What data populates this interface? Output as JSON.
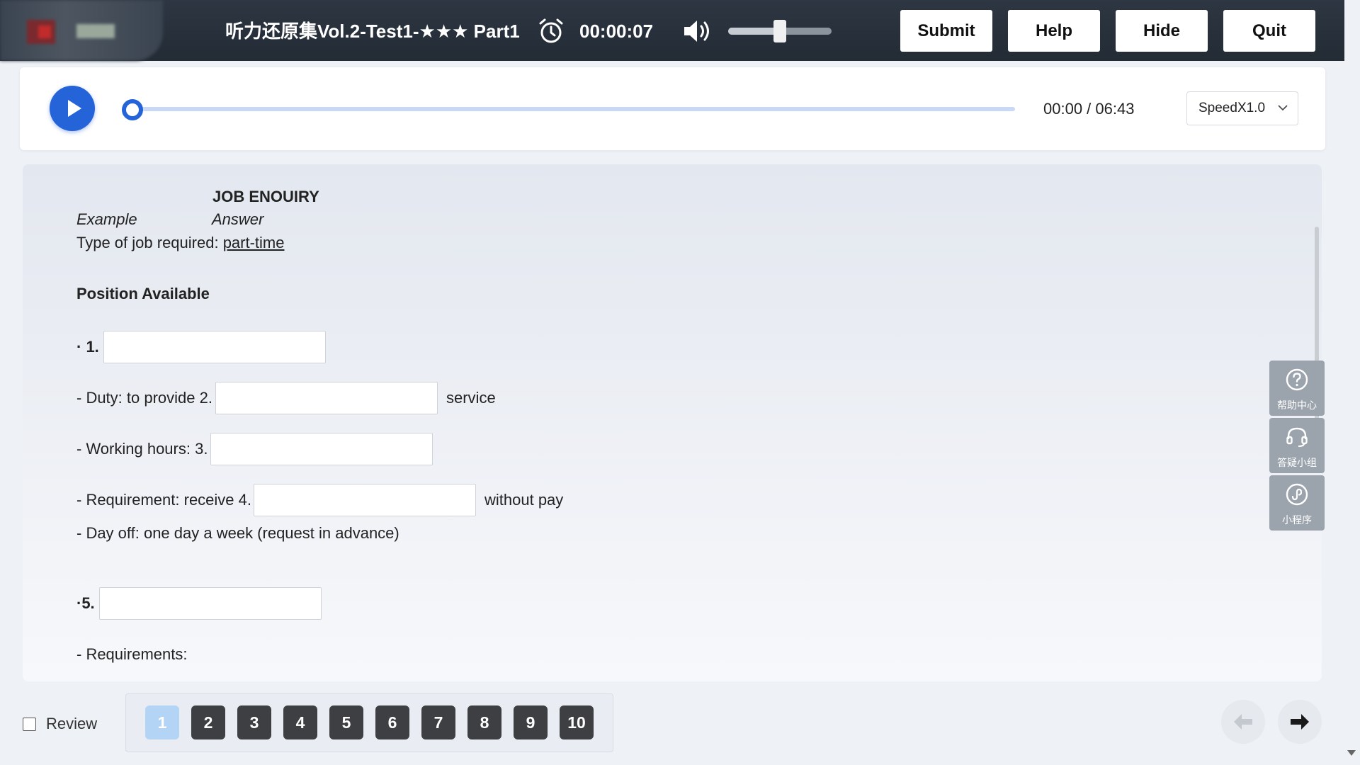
{
  "header": {
    "title": "听力还原集Vol.2-Test1-★★★ Part1",
    "timer": "00:00:07",
    "volume_level": 0.5,
    "buttons": {
      "submit": "Submit",
      "help": "Help",
      "hide": "Hide",
      "quit": "Quit"
    },
    "icons": {
      "clock": "alarm-clock-icon",
      "volume": "speaker-icon"
    }
  },
  "player": {
    "progress": 0,
    "current_time": "00:00",
    "total_time": "06:43",
    "time_separator": " / ",
    "speed": "SpeedX1.0",
    "accent_color": "#2563d9"
  },
  "form": {
    "heading": "JOB ENOUIRY",
    "example_label": "Example",
    "answer_label": "Answer",
    "example_prefix": "Type of job required: ",
    "example_answer": "part-time",
    "section_title": "Position Available",
    "q1_prefix": "· 1.",
    "q2_prefix": "- Duty: to provide 2.",
    "q2_suffix": "service",
    "q3_prefix": "- Working hours: 3.",
    "q4_prefix": "- Requirement: receive 4.",
    "q4_suffix": "without pay",
    "dayoff_line": "- Day off: one day a week (request in advance)",
    "q5_prefix": "·5.",
    "requirements_line": "- Requirements:",
    "answers": {
      "q1": "",
      "q2": "",
      "q3": "",
      "q4": "",
      "q5": ""
    }
  },
  "side_widgets": [
    {
      "label": "帮助中心",
      "icon": "question-circle-icon"
    },
    {
      "label": "答疑小组",
      "icon": "headset-icon"
    },
    {
      "label": "小程序",
      "icon": "mini-program-icon"
    }
  ],
  "footer": {
    "review_label": "Review",
    "review_checked": false,
    "questions": [
      "1",
      "2",
      "3",
      "4",
      "5",
      "6",
      "7",
      "8",
      "9",
      "10"
    ],
    "active_question": "1",
    "prev_icon": "arrow-left-icon",
    "next_icon": "arrow-right-icon"
  }
}
